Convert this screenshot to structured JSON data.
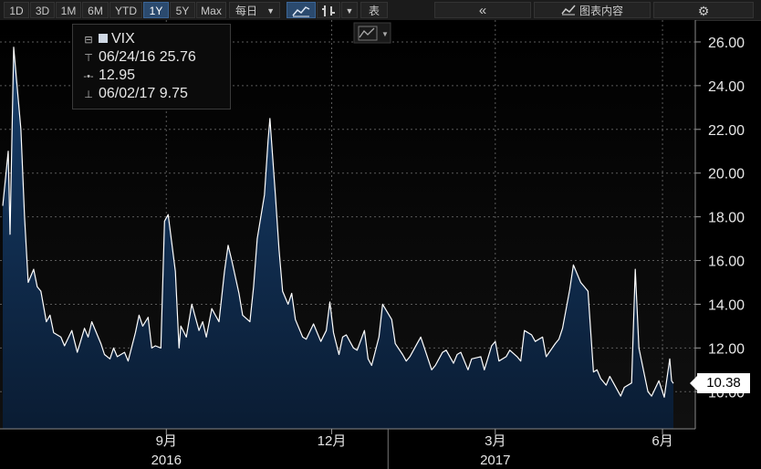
{
  "toolbar": {
    "ranges": [
      "1D",
      "3D",
      "1M",
      "6M",
      "YTD",
      "1Y",
      "5Y",
      "Max"
    ],
    "active_range": "1Y",
    "frequency": "每日",
    "table_label": "表",
    "chart_content_label": "图表内容"
  },
  "legend": {
    "ticker": "VIX",
    "high": "06/24/16 25.76",
    "last": "12.95",
    "low": "06/02/17 9.75"
  },
  "last_value_label": "10.38",
  "colors": {
    "line": "#ffffff",
    "fill_top": "#173e6b",
    "fill_bottom": "#0b1d33",
    "grid": "#5a5a5a",
    "background": "#000000"
  },
  "chart_data": {
    "type": "area",
    "ylim": [
      8.3,
      27
    ],
    "y_ticks": [
      "10.00",
      "12.00",
      "14.00",
      "16.00",
      "18.00",
      "20.00",
      "22.00",
      "24.00",
      "26.00"
    ],
    "y_tick_values": [
      10,
      12,
      14,
      16,
      18,
      20,
      22,
      24,
      26
    ],
    "x_month_labels": [
      {
        "label": "9月",
        "date": "2016-09-01"
      },
      {
        "label": "12月",
        "date": "2016-12-01"
      },
      {
        "label": "3月",
        "date": "2017-03-01"
      },
      {
        "label": "6月",
        "date": "2017-06-01"
      }
    ],
    "x_year_labels": [
      {
        "label": "2016",
        "date": "2016-09-01"
      },
      {
        "label": "2017",
        "date": "2017-03-01"
      }
    ],
    "x_range": [
      "2016-06-03",
      "2017-06-07"
    ],
    "grid": true,
    "series": [
      {
        "values": [
          [
            "2016-06-03",
            18.5
          ],
          [
            "2016-06-06",
            21.0
          ],
          [
            "2016-06-07",
            17.2
          ],
          [
            "2016-06-09",
            25.76
          ],
          [
            "2016-06-13",
            22.0
          ],
          [
            "2016-06-15",
            18.0
          ],
          [
            "2016-06-17",
            15.0
          ],
          [
            "2016-06-20",
            15.6
          ],
          [
            "2016-06-22",
            14.8
          ],
          [
            "2016-06-24",
            14.6
          ],
          [
            "2016-06-27",
            13.2
          ],
          [
            "2016-06-29",
            13.5
          ],
          [
            "2016-07-01",
            12.7
          ],
          [
            "2016-07-05",
            12.5
          ],
          [
            "2016-07-07",
            12.1
          ],
          [
            "2016-07-11",
            12.8
          ],
          [
            "2016-07-14",
            11.8
          ],
          [
            "2016-07-18",
            12.9
          ],
          [
            "2016-07-20",
            12.5
          ],
          [
            "2016-07-22",
            13.2
          ],
          [
            "2016-07-25",
            12.6
          ],
          [
            "2016-07-27",
            12.2
          ],
          [
            "2016-07-29",
            11.7
          ],
          [
            "2016-08-01",
            11.5
          ],
          [
            "2016-08-03",
            12.0
          ],
          [
            "2016-08-05",
            11.6
          ],
          [
            "2016-08-09",
            11.8
          ],
          [
            "2016-08-11",
            11.4
          ],
          [
            "2016-08-15",
            12.7
          ],
          [
            "2016-08-17",
            13.5
          ],
          [
            "2016-08-19",
            13.0
          ],
          [
            "2016-08-22",
            13.4
          ],
          [
            "2016-08-24",
            12.0
          ],
          [
            "2016-08-26",
            12.1
          ],
          [
            "2016-08-29",
            12.0
          ],
          [
            "2016-08-31",
            17.8
          ],
          [
            "2016-09-02",
            18.1
          ],
          [
            "2016-09-06",
            15.5
          ],
          [
            "2016-09-08",
            12.0
          ],
          [
            "2016-09-09",
            13.0
          ],
          [
            "2016-09-12",
            12.5
          ],
          [
            "2016-09-15",
            14.0
          ],
          [
            "2016-09-19",
            12.8
          ],
          [
            "2016-09-21",
            13.2
          ],
          [
            "2016-09-23",
            12.5
          ],
          [
            "2016-09-26",
            13.8
          ],
          [
            "2016-09-28",
            13.5
          ],
          [
            "2016-09-30",
            13.2
          ],
          [
            "2016-10-03",
            15.5
          ],
          [
            "2016-10-05",
            16.7
          ],
          [
            "2016-10-07",
            16.0
          ],
          [
            "2016-10-11",
            14.5
          ],
          [
            "2016-10-13",
            13.5
          ],
          [
            "2016-10-17",
            13.2
          ],
          [
            "2016-10-19",
            14.8
          ],
          [
            "2016-10-21",
            17.0
          ],
          [
            "2016-10-25",
            19.0
          ],
          [
            "2016-10-27",
            21.5
          ],
          [
            "2016-10-28",
            22.5
          ],
          [
            "2016-10-31",
            19.0
          ],
          [
            "2016-11-02",
            16.5
          ],
          [
            "2016-11-04",
            14.6
          ],
          [
            "2016-11-07",
            14.0
          ],
          [
            "2016-11-09",
            14.5
          ],
          [
            "2016-11-11",
            13.3
          ],
          [
            "2016-11-15",
            12.5
          ],
          [
            "2016-11-17",
            12.4
          ],
          [
            "2016-11-21",
            13.1
          ],
          [
            "2016-11-23",
            12.7
          ],
          [
            "2016-11-25",
            12.3
          ],
          [
            "2016-11-28",
            12.8
          ],
          [
            "2016-11-30",
            14.1
          ],
          [
            "2016-12-02",
            12.7
          ],
          [
            "2016-12-05",
            11.7
          ],
          [
            "2016-12-07",
            12.5
          ],
          [
            "2016-12-09",
            12.6
          ],
          [
            "2016-12-13",
            12.0
          ],
          [
            "2016-12-15",
            11.9
          ],
          [
            "2016-12-19",
            12.8
          ],
          [
            "2016-12-21",
            11.5
          ],
          [
            "2016-12-23",
            11.2
          ],
          [
            "2016-12-27",
            12.5
          ],
          [
            "2016-12-29",
            14.0
          ],
          [
            "2017-01-03",
            13.3
          ],
          [
            "2017-01-05",
            12.2
          ],
          [
            "2017-01-09",
            11.7
          ],
          [
            "2017-01-11",
            11.4
          ],
          [
            "2017-01-13",
            11.6
          ],
          [
            "2017-01-17",
            12.2
          ],
          [
            "2017-01-19",
            12.5
          ],
          [
            "2017-01-23",
            11.5
          ],
          [
            "2017-01-25",
            11.0
          ],
          [
            "2017-01-27",
            11.2
          ],
          [
            "2017-01-31",
            11.8
          ],
          [
            "2017-02-02",
            11.9
          ],
          [
            "2017-02-06",
            11.3
          ],
          [
            "2017-02-08",
            11.7
          ],
          [
            "2017-02-10",
            11.8
          ],
          [
            "2017-02-14",
            11.0
          ],
          [
            "2017-02-16",
            11.5
          ],
          [
            "2017-02-21",
            11.6
          ],
          [
            "2017-02-23",
            11.0
          ],
          [
            "2017-02-27",
            12.1
          ],
          [
            "2017-03-01",
            12.3
          ],
          [
            "2017-03-03",
            11.4
          ],
          [
            "2017-03-07",
            11.6
          ],
          [
            "2017-03-09",
            11.9
          ],
          [
            "2017-03-13",
            11.6
          ],
          [
            "2017-03-15",
            11.4
          ],
          [
            "2017-03-17",
            12.8
          ],
          [
            "2017-03-21",
            12.6
          ],
          [
            "2017-03-23",
            12.3
          ],
          [
            "2017-03-27",
            12.5
          ],
          [
            "2017-03-29",
            11.6
          ],
          [
            "2017-04-03",
            12.2
          ],
          [
            "2017-04-05",
            12.4
          ],
          [
            "2017-04-07",
            12.9
          ],
          [
            "2017-04-11",
            14.7
          ],
          [
            "2017-04-13",
            15.8
          ],
          [
            "2017-04-17",
            15.0
          ],
          [
            "2017-04-19",
            14.8
          ],
          [
            "2017-04-21",
            14.6
          ],
          [
            "2017-04-24",
            10.9
          ],
          [
            "2017-04-26",
            11.0
          ],
          [
            "2017-04-28",
            10.6
          ],
          [
            "2017-05-01",
            10.3
          ],
          [
            "2017-05-03",
            10.7
          ],
          [
            "2017-05-05",
            10.4
          ],
          [
            "2017-05-09",
            9.8
          ],
          [
            "2017-05-11",
            10.2
          ],
          [
            "2017-05-15",
            10.4
          ],
          [
            "2017-05-17",
            15.6
          ],
          [
            "2017-05-19",
            12.0
          ],
          [
            "2017-05-22",
            10.8
          ],
          [
            "2017-05-24",
            10.0
          ],
          [
            "2017-05-26",
            9.8
          ],
          [
            "2017-05-30",
            10.5
          ],
          [
            "2017-06-01",
            10.0
          ],
          [
            "2017-06-02",
            9.75
          ],
          [
            "2017-06-05",
            11.5
          ],
          [
            "2017-06-06",
            10.5
          ],
          [
            "2017-06-07",
            10.38
          ]
        ]
      }
    ]
  }
}
